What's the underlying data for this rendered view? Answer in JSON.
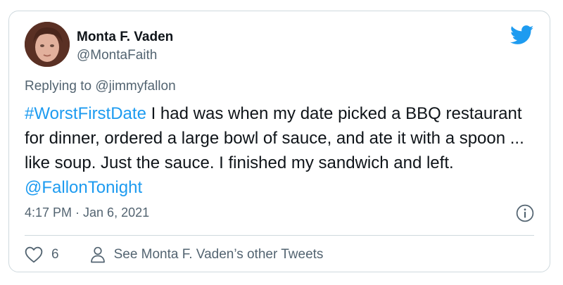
{
  "author": {
    "name": "Monta F. Vaden",
    "handle": "@MontaFaith"
  },
  "reply": {
    "prefix": "Replying to",
    "mention": "@jimmyfallon"
  },
  "tweet": {
    "hashtag": "#WorstFirstDate",
    "body": " I had was when my date picked a BBQ restaurant for dinner, ordered a large bowl of sauce, and ate it with a spoon ... like soup. Just the sauce. I finished my sandwich and left. ",
    "mention": "@FallonTonight"
  },
  "timestamp": "4:17 PM · Jan 6, 2021",
  "actions": {
    "like_count": "6",
    "other_tweets_label": "See Monta F. Vaden’s other Tweets"
  },
  "icons": {
    "logo": "twitter-bird-icon",
    "info": "info-icon",
    "like": "heart-icon",
    "profile": "person-icon"
  },
  "colors": {
    "brand": "#1d9bf0",
    "text": "#0f1419",
    "muted": "#536471",
    "border": "#cfd9de"
  }
}
